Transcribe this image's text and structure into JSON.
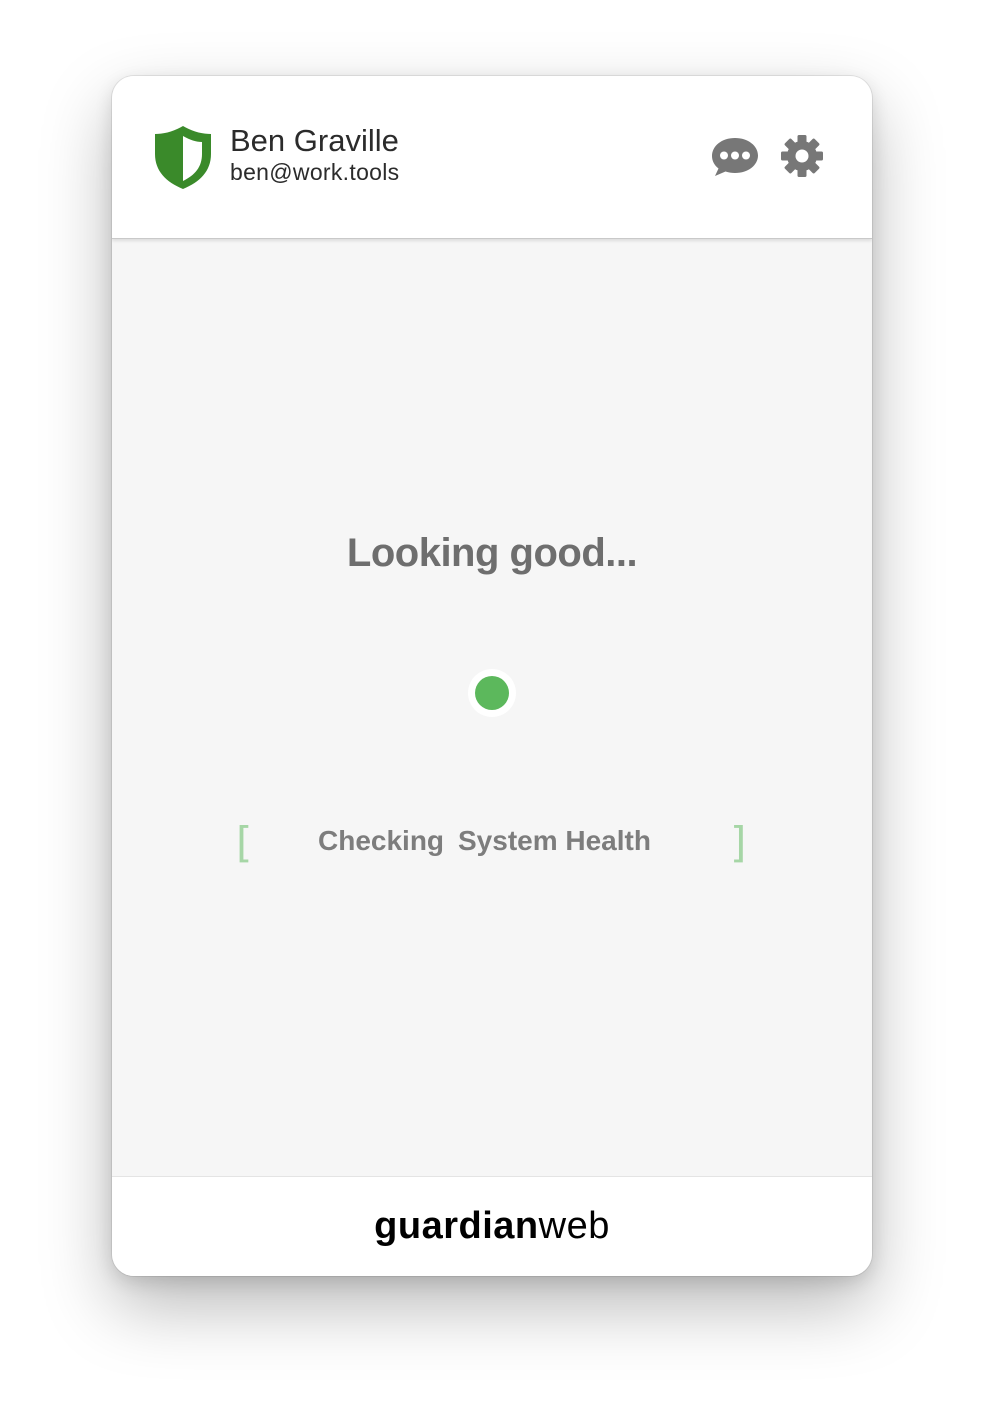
{
  "header": {
    "user_name": "Ben Graville",
    "user_email": "ben@work.tools",
    "shield_icon": "shield-icon",
    "chat_icon": "chat-bubble-icon",
    "settings_icon": "gear-icon"
  },
  "status": {
    "title": "Looking good...",
    "indicator_color": "#5cb85c",
    "check_verb": "Checking",
    "check_target": "System Health",
    "bracket_left": "[",
    "bracket_right": "]"
  },
  "footer": {
    "brand_bold": "guardian",
    "brand_light": "web"
  },
  "colors": {
    "accent_green": "#3a8a2a",
    "status_green": "#5cb85c",
    "icon_gray": "#777777",
    "text_gray": "#6e6e6e"
  }
}
